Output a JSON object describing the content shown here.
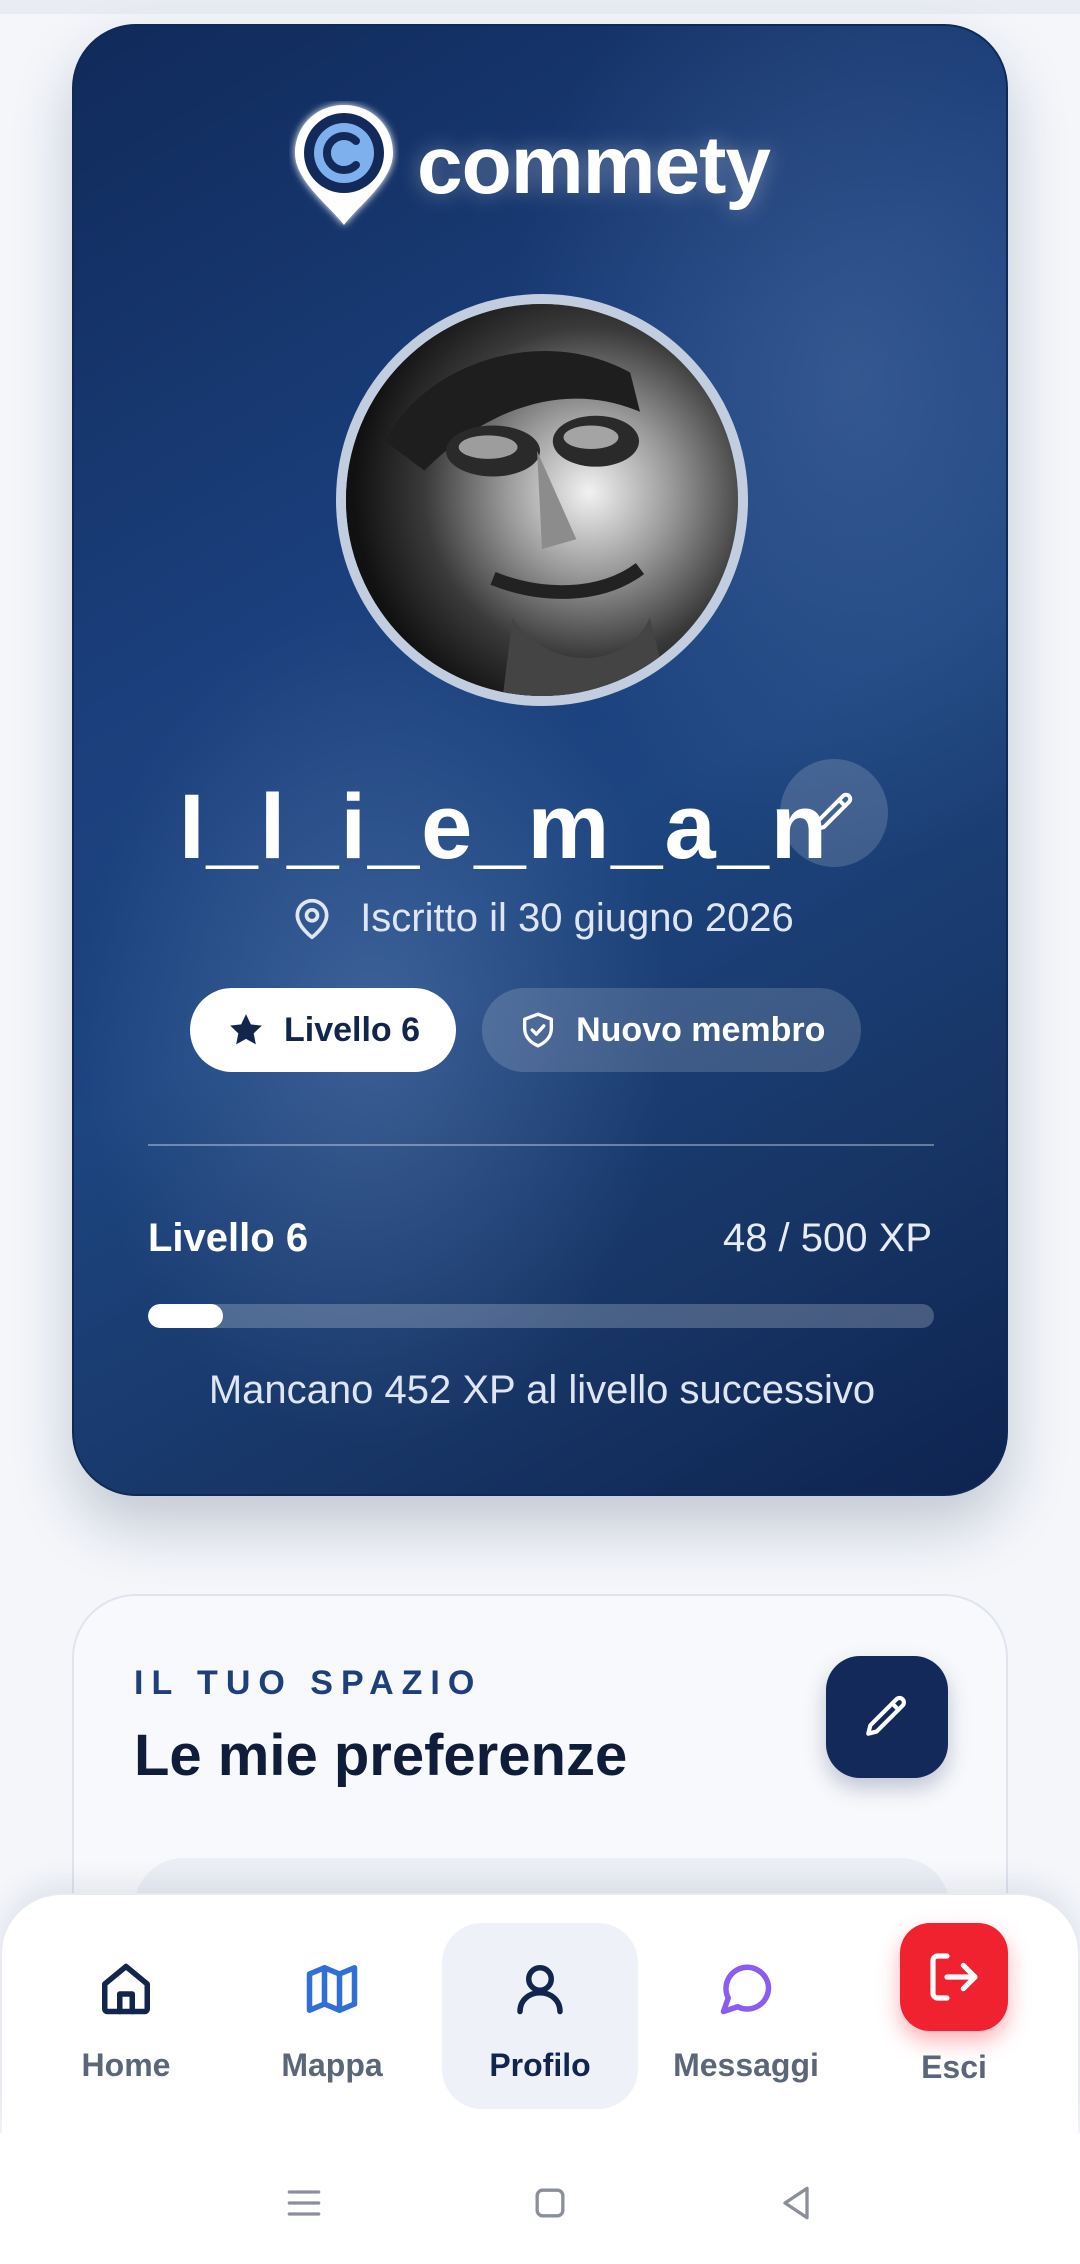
{
  "app": {
    "brand_name": "commety"
  },
  "profile": {
    "username": "I_l_i_e_m_a_n",
    "joined_text": "Iscritto il 30 giugno 2026",
    "badges": {
      "level_label": "Livello 6",
      "member_label": "Nuovo membro"
    },
    "xp": {
      "level_label": "Livello 6",
      "amount_text": "48 / 500 XP",
      "current": 48,
      "max": 500,
      "remaining_text": "Mancano 452 XP al livello successivo"
    }
  },
  "preferences": {
    "eyebrow": "IL TUO SPAZIO",
    "title": "Le mie preferenze"
  },
  "bottom_nav": {
    "items": [
      {
        "label": "Home",
        "icon": "home-icon"
      },
      {
        "label": "Mappa",
        "icon": "map-icon"
      },
      {
        "label": "Profilo",
        "icon": "user-icon",
        "active": true
      },
      {
        "label": "Messaggi",
        "icon": "chat-bubble-icon"
      },
      {
        "label": "Esci",
        "icon": "logout-icon"
      }
    ]
  },
  "colors": {
    "card_navy": "#1b3f7c",
    "accent_navy": "#12295a",
    "exit_red": "#f0222f",
    "map_blue": "#2f6fd6",
    "messages_purple": "#8a5cf0"
  }
}
